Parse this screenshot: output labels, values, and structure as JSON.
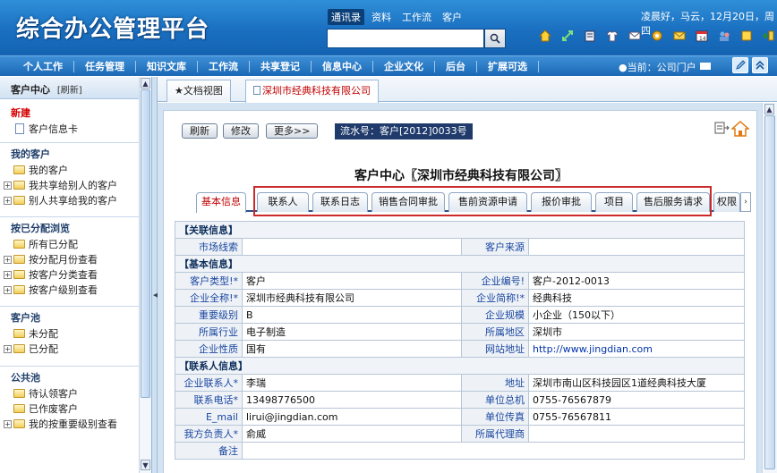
{
  "header": {
    "logo": "综合办公管理平台",
    "search_tabs": [
      "通讯录",
      "资料",
      "工作流",
      "客户"
    ],
    "greeting": "凌晨好，马云，12月20日，周四"
  },
  "nav": {
    "items": [
      "个人工作",
      "任务管理",
      "知识文库",
      "工作流",
      "共享登记",
      "信息中心",
      "企业文化",
      "后台",
      "扩展可选"
    ],
    "current": "●当前：公司门户"
  },
  "sidebar": {
    "title": "客户中心",
    "refresh": "[刷新]",
    "sections": [
      {
        "title": "新建",
        "items": [
          "客户信息卡"
        ]
      },
      {
        "title": "我的客户",
        "items": [
          "我的客户",
          "我共享给别人的客户",
          "别人共享给我的客户"
        ]
      },
      {
        "title": "按已分配浏览",
        "items": [
          "所有已分配",
          "按分配月份查看",
          "按客户分类查看",
          "按客户级别查看"
        ]
      },
      {
        "title": "客户池",
        "items": [
          "未分配",
          "已分配"
        ]
      },
      {
        "title": "公共池",
        "items": [
          "待认领客户",
          "已作废客户",
          "我的按重要级别查看"
        ]
      }
    ]
  },
  "tabs": [
    "★文档视图",
    "深圳市经典科技有限公司"
  ],
  "toolbar": {
    "refresh": "刷新",
    "edit": "修改",
    "more": "更多>>",
    "serial": "流水号：客户[2012]0033号"
  },
  "doc_title": "客户中心〖深圳市经典科技有限公司〗",
  "inner_tabs": [
    "基本信息",
    "联系人",
    "联系日志",
    "销售合同审批",
    "售前资源申请",
    "报价审批",
    "项目",
    "售后服务请求",
    "权限"
  ],
  "form": {
    "sec1": "【关联信息】",
    "market_clue_label": "市场线索",
    "market_clue": "",
    "source_label": "客户来源",
    "source": "",
    "sec2": "【基本信息】",
    "type_label": "客户类型!*",
    "type": "客户",
    "code_label": "企业编号!",
    "code": "客户-2012-0013",
    "fullname_label": "企业全称!*",
    "fullname": "深圳市经典科技有限公司",
    "short_label": "企业简称!*",
    "short": "经典科技",
    "importance_label": "重要级别",
    "importance": "B",
    "scale_label": "企业规模",
    "scale": "小企业（150以下）",
    "industry_label": "所属行业",
    "industry": "电子制造",
    "region_label": "所属地区",
    "region": "深圳市",
    "nature_label": "企业性质",
    "nature": "国有",
    "website_label": "网站地址",
    "website": "http://www.jingdian.com",
    "sec3": "【联系人信息】",
    "contact_label": "企业联系人*",
    "contact": "李瑞",
    "address_label": "地址",
    "address": "深圳市南山区科技园区1道经典科技大厦",
    "phone_label": "联系电话*",
    "phone": "13498776500",
    "tel_label": "单位总机",
    "tel": "0755-76567879",
    "email_label": "E_mail",
    "email": "lirui@jingdian.com",
    "fax_label": "单位传真",
    "fax": "0755-76567811",
    "owner_label": "我方负责人*",
    "owner": "俞威",
    "agent_label": "所属代理商",
    "agent": "",
    "remark_label": "备注",
    "remark": ""
  }
}
